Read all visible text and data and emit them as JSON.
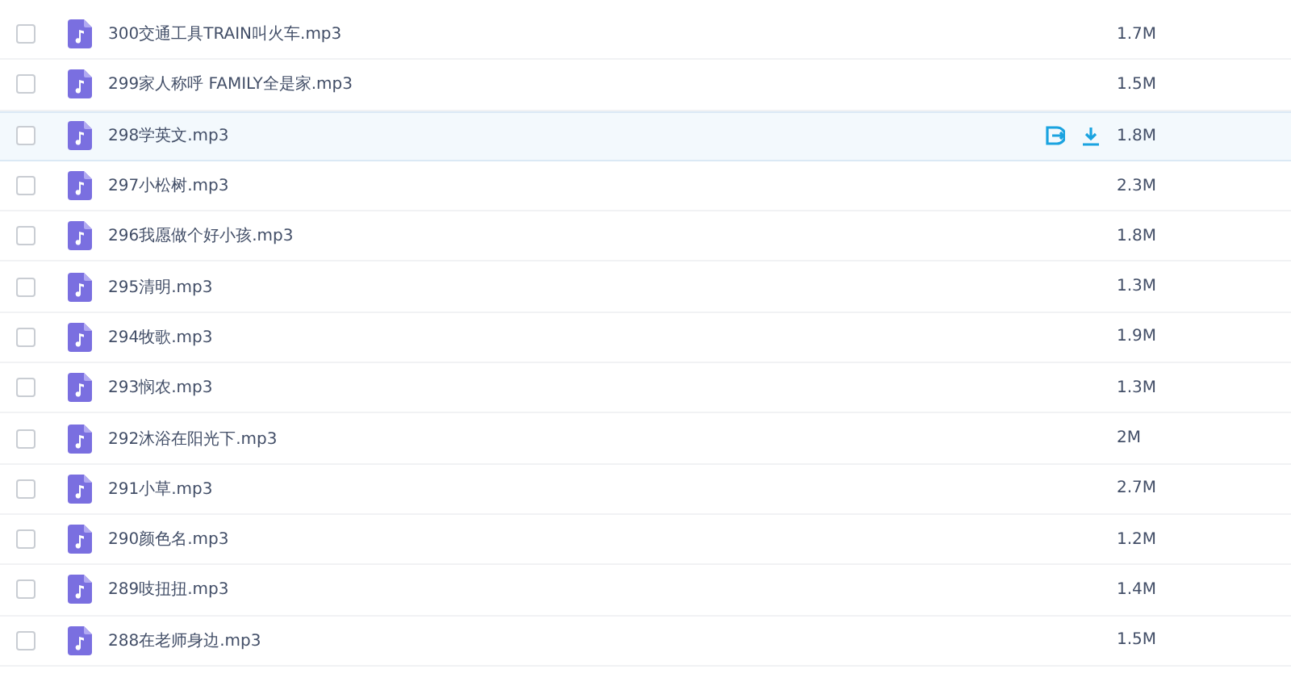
{
  "files": [
    {
      "name": "300交通工具TRAIN叫火车.mp3",
      "size": "1.7M",
      "checked": false,
      "hovered": false
    },
    {
      "name": "299家人称呼 FAMILY全是家.mp3",
      "size": "1.5M",
      "checked": false,
      "hovered": false
    },
    {
      "name": "298学英文.mp3",
      "size": "1.8M",
      "checked": false,
      "hovered": true
    },
    {
      "name": "297小松树.mp3",
      "size": "2.3M",
      "checked": false,
      "hovered": false
    },
    {
      "name": "296我愿做个好小孩.mp3",
      "size": "1.8M",
      "checked": false,
      "hovered": false
    },
    {
      "name": "295清明.mp3",
      "size": "1.3M",
      "checked": false,
      "hovered": false
    },
    {
      "name": "294牧歌.mp3",
      "size": "1.9M",
      "checked": false,
      "hovered": false
    },
    {
      "name": "293悯农.mp3",
      "size": "1.3M",
      "checked": false,
      "hovered": false
    },
    {
      "name": "292沐浴在阳光下.mp3",
      "size": "2M",
      "checked": false,
      "hovered": false
    },
    {
      "name": "291小草.mp3",
      "size": "2.7M",
      "checked": false,
      "hovered": false
    },
    {
      "name": "290颜色名.mp3",
      "size": "1.2M",
      "checked": false,
      "hovered": false
    },
    {
      "name": "289吱扭扭.mp3",
      "size": "1.4M",
      "checked": false,
      "hovered": false
    },
    {
      "name": "288在老师身边.mp3",
      "size": "1.5M",
      "checked": false,
      "hovered": false
    }
  ]
}
